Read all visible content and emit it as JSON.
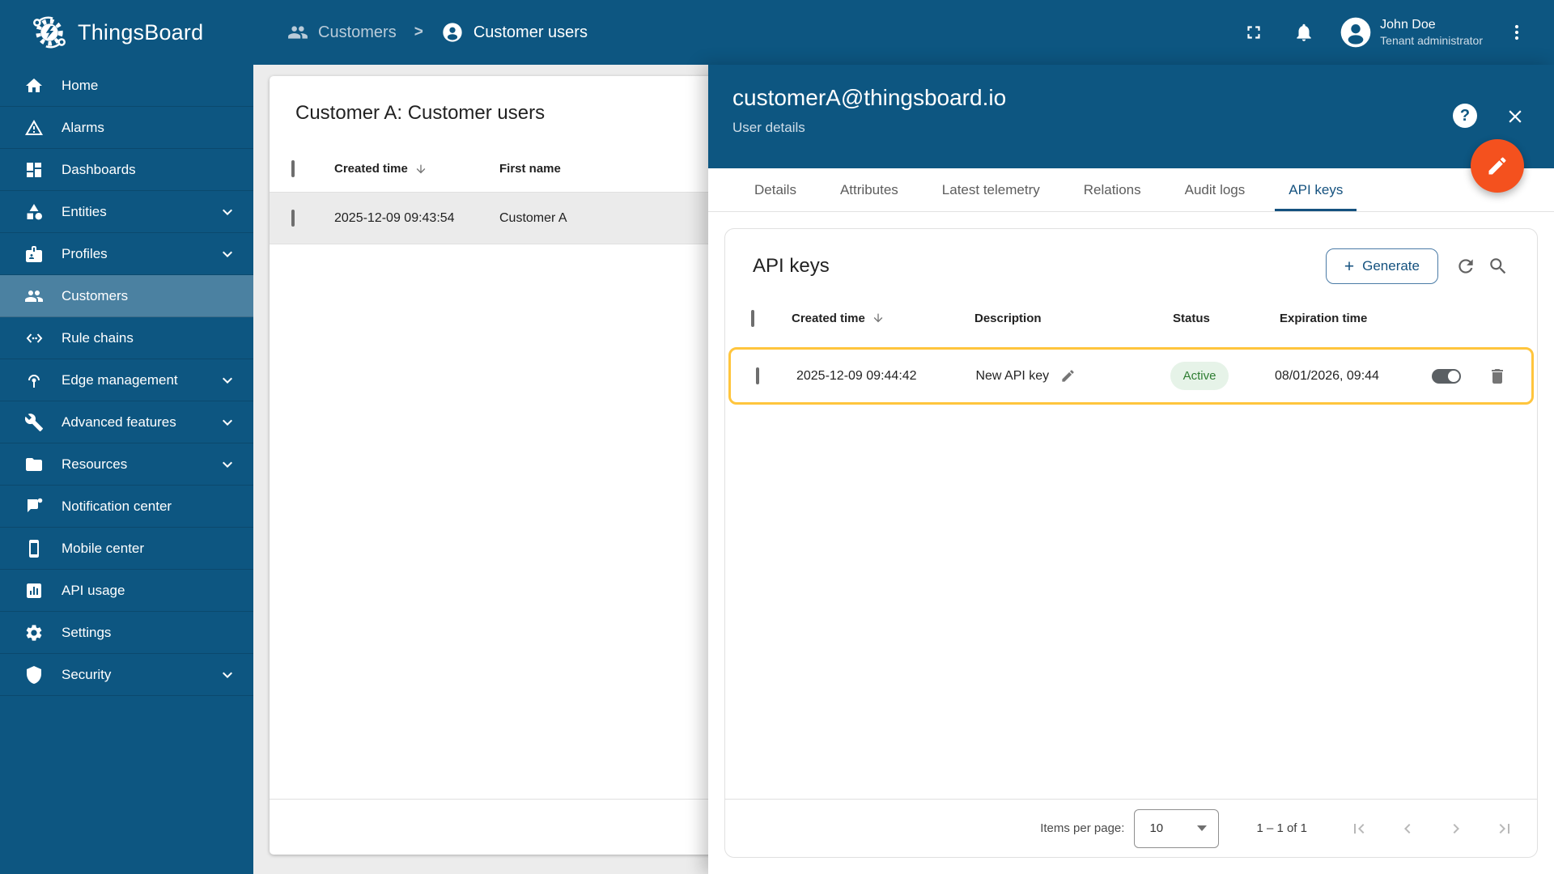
{
  "app": {
    "title": "ThingsBoard"
  },
  "topbar": {
    "breadcrumb": [
      {
        "label": "Customers"
      },
      {
        "label": "Customer users"
      }
    ],
    "separator": ">",
    "user": {
      "name": "John Doe",
      "role": "Tenant administrator"
    }
  },
  "sidebar": {
    "items": [
      {
        "label": "Home"
      },
      {
        "label": "Alarms"
      },
      {
        "label": "Dashboards"
      },
      {
        "label": "Entities",
        "expandable": true
      },
      {
        "label": "Profiles",
        "expandable": true
      },
      {
        "label": "Customers",
        "selected": true
      },
      {
        "label": "Rule chains"
      },
      {
        "label": "Edge management",
        "expandable": true
      },
      {
        "label": "Advanced features",
        "expandable": true
      },
      {
        "label": "Resources",
        "expandable": true
      },
      {
        "label": "Notification center"
      },
      {
        "label": "Mobile center"
      },
      {
        "label": "API usage"
      },
      {
        "label": "Settings"
      },
      {
        "label": "Security",
        "expandable": true
      }
    ]
  },
  "users_panel": {
    "title": "Customer A: Customer users",
    "columns": [
      "Created time",
      "First name"
    ],
    "row": {
      "created_time": "2025-12-09 09:43:54",
      "first_name": "Customer A"
    }
  },
  "drawer": {
    "title": "customerA@thingsboard.io",
    "subtitle": "User details",
    "tabs": [
      {
        "label": "Details"
      },
      {
        "label": "Attributes"
      },
      {
        "label": "Latest telemetry"
      },
      {
        "label": "Relations"
      },
      {
        "label": "Audit logs"
      },
      {
        "label": "API keys",
        "active": true
      }
    ]
  },
  "api_keys": {
    "title": "API keys",
    "generate_label": "Generate",
    "columns": [
      "Created time",
      "Description",
      "Status",
      "Expiration time"
    ],
    "row": {
      "created_time": "2025-12-09 09:44:42",
      "description": "New API key",
      "status": "Active",
      "expiration": "08/01/2026, 09:44",
      "enabled": true
    },
    "pagination": {
      "items_per_page_label": "Items per page:",
      "page_size": "10",
      "range": "1 – 1 of 1"
    }
  },
  "colors": {
    "primary_blue": "#0d5681",
    "tab_active_blue": "#15527f",
    "fab_orange": "#f4511e",
    "row_highlight": "#ffc53d",
    "status_active_green": "#2e7d32"
  }
}
